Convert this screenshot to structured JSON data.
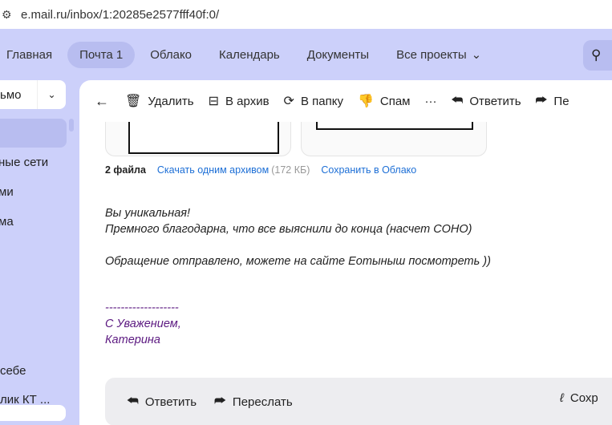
{
  "browser": {
    "url": "e.mail.ru/inbox/1:20285e2577fff40f:0/"
  },
  "nav": {
    "items": [
      "Главная",
      "Почта 1",
      "Облако",
      "Календарь",
      "Документы",
      "Все проекты"
    ]
  },
  "sidebar": {
    "compose": "ьмо",
    "items": [
      "ные сети",
      "ми",
      "ма",
      "себе",
      "лик КТ ..."
    ]
  },
  "toolbar": {
    "delete": "Удалить",
    "archive": "В архив",
    "move": "В папку",
    "spam": "Спам",
    "more": "···",
    "reply": "Ответить",
    "forward": "Пе"
  },
  "attachments": {
    "count": "2 файла",
    "download": "Скачать одним архивом",
    "size": "(172 КБ)",
    "save": "Сохранить в Облако"
  },
  "message": {
    "lines": [
      "Вы уникальная!",
      "Премного благодарна, что все выяснили до конца (насчет СОНО)",
      "",
      "Обращение отправлено, можете на сайте Еотыныш посмотреть ))"
    ],
    "signature": [
      "-------------------",
      "С Уважением,",
      "Катерина"
    ]
  },
  "bottom": {
    "reply": "Ответить",
    "forward": "Переслать",
    "save": "Сохр"
  }
}
